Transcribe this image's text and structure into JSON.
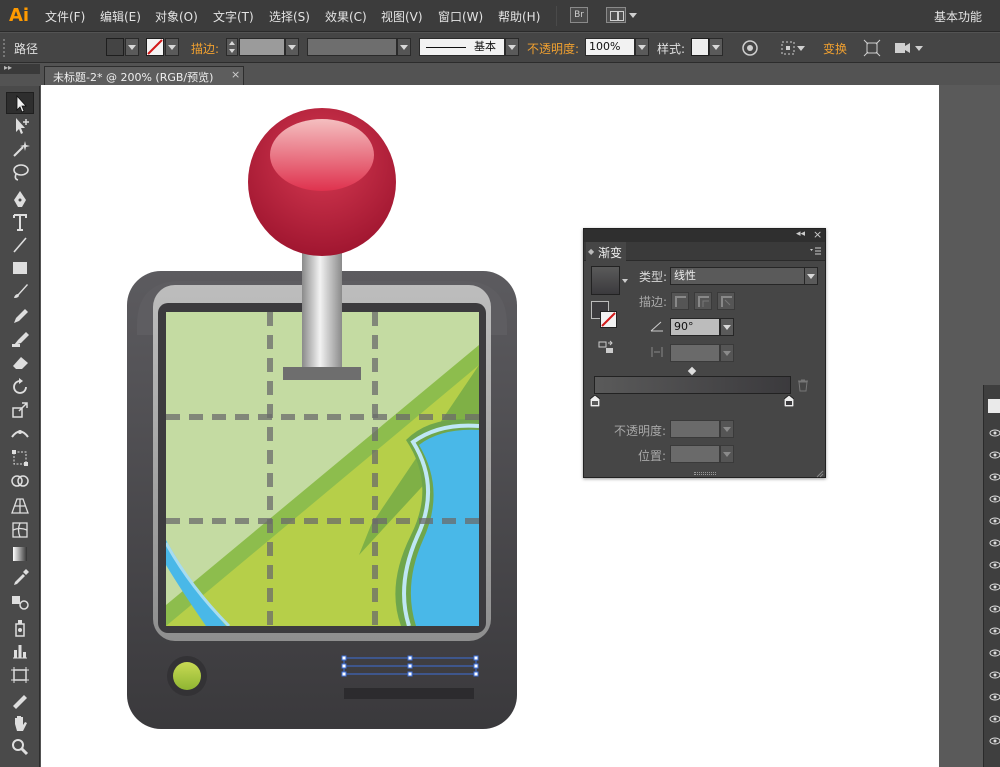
{
  "app": {
    "logo": "Ai",
    "menu": [
      "文件(F)",
      "编辑(E)",
      "对象(O)",
      "文字(T)",
      "选择(S)",
      "效果(C)",
      "视图(V)",
      "窗口(W)",
      "帮助(H)"
    ],
    "bridge_label": "Br",
    "workspace": "基本功能"
  },
  "control_bar": {
    "selection_type": "路径",
    "stroke_label": "描边:",
    "stroke_style": "基本",
    "opacity_label": "不透明度:",
    "opacity_value": "100%",
    "style_label": "样式:",
    "transform_label": "变换"
  },
  "document": {
    "tab_title": "未标题-2* @ 200% (RGB/预览)",
    "close": "×"
  },
  "gradient_panel": {
    "title": "渐变",
    "type_label": "类型:",
    "type_value": "线性",
    "stroke_label": "描边:",
    "angle_value": "90°",
    "opacity_label": "不透明度:",
    "position_label": "位置:",
    "colors": {
      "start": "#5a5a5a",
      "end": "#3b3a3d"
    }
  },
  "colors": {
    "accent_orange": "#f0a030",
    "pin_red": "#c8223e",
    "screen_green": "#8dbd4d",
    "water_blue": "#49b8e8",
    "device_dark": "#414043"
  }
}
